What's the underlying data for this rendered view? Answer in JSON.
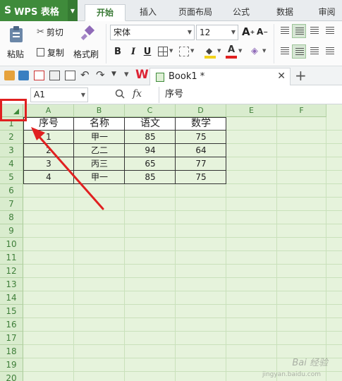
{
  "app": {
    "logo": "S",
    "name": "WPS 表格"
  },
  "tabs": [
    {
      "label": "开始",
      "active": true
    },
    {
      "label": "插入"
    },
    {
      "label": "页面布局"
    },
    {
      "label": "公式"
    },
    {
      "label": "数据"
    },
    {
      "label": "审阅"
    }
  ],
  "ribbon": {
    "paste": "粘贴",
    "cut": "剪切",
    "copy": "复制",
    "format_painter": "格式刷",
    "font_name": "宋体",
    "font_size": "12",
    "bold": "B",
    "italic": "I",
    "underline": "U",
    "grow": "A",
    "shrink": "A"
  },
  "document": {
    "tab_title": "Book1 *",
    "close": "✕",
    "new_tab": "+"
  },
  "formula_bar": {
    "cell_ref": "A1",
    "fx": "fx",
    "content": "序号"
  },
  "columns": [
    "A",
    "B",
    "C",
    "D",
    "E",
    "F"
  ],
  "rows": [
    "1",
    "2",
    "3",
    "4",
    "5",
    "6",
    "7",
    "8",
    "9",
    "10",
    "11",
    "12",
    "13",
    "14",
    "15",
    "16",
    "17",
    "18",
    "19",
    "20"
  ],
  "table": {
    "header": [
      "序号",
      "名称",
      "语文",
      "数学"
    ],
    "body": [
      [
        "1",
        "甲一",
        "85",
        "75"
      ],
      [
        "2",
        "乙二",
        "94",
        "64"
      ],
      [
        "3",
        "丙三",
        "65",
        "77"
      ],
      [
        "4",
        "甲一",
        "85",
        "75"
      ]
    ]
  },
  "watermark": {
    "line1": "Bai 经验",
    "line2": "jingyan.baidu.com"
  },
  "colors": {
    "brand": "#3f8b3b",
    "sheet_bg": "#e6f3dc",
    "annotation": "#e02020"
  }
}
